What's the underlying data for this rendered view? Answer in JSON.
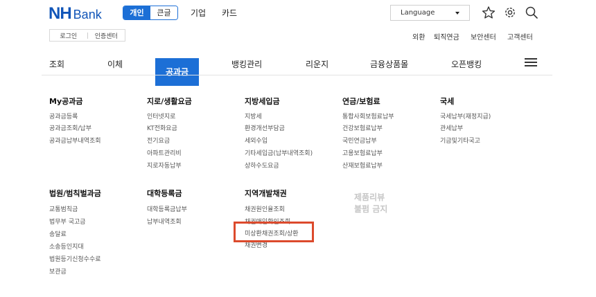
{
  "brand": {
    "nh": "NH",
    "bank": "Bank"
  },
  "segment": {
    "personal": "개인",
    "corporate": "큰글"
  },
  "top_menu": [
    "기업",
    "카드"
  ],
  "language": {
    "label": "Language"
  },
  "login_bar": {
    "login": "로그인",
    "cert": "인증센터"
  },
  "utility": [
    "외환",
    "퇴직연금",
    "보안센터",
    "고객센터"
  ],
  "gnb": {
    "items": [
      "조회",
      "이체",
      "공과금",
      "뱅킹관리",
      "리운지",
      "금융상품몰",
      "오픈뱅킹"
    ],
    "active": "공과금"
  },
  "columns": [
    {
      "title": "My공과금",
      "items": [
        "공과금등록",
        "공과금조회/납부",
        "공과금납부내역조회"
      ]
    },
    {
      "title": "지로/생활요금",
      "items": [
        "인터넷지로",
        "KT전화요금",
        "전기요금",
        "아파트관리비",
        "지로자동납부"
      ]
    },
    {
      "title": "지방세입금",
      "items": [
        "지방세",
        "환경개선부담금",
        "세외수입",
        "기타세입금(납부내역조회)",
        "상하수도요금"
      ]
    },
    {
      "title": "연금/보험료",
      "items": [
        "통합사회보험료납부",
        "건강보험료납부",
        "국민연금납부",
        "고용보험료납부",
        "산재보험료납부"
      ]
    },
    {
      "title": "국세",
      "items": [
        "국세납부(재정지급)",
        "관세납부",
        "기금및기타국고"
      ]
    },
    {
      "title": "법원/범칙벌과금",
      "items": [
        "교통범칙금",
        "법무부 국고금",
        "송달료",
        "소송등인지대",
        "법원등기신청수수료",
        "보관금"
      ]
    },
    {
      "title": "대학등록금",
      "items": [
        "대학등록금납부",
        "납부내역조회"
      ]
    },
    {
      "title": "지역개발채권",
      "items": [
        "채권원인율조회",
        "채권매입확인조회",
        "미상환채권조회/상환",
        "채권변경"
      ]
    }
  ],
  "watermark": {
    "line1": "제품리뷰",
    "line2": "불펌 금지"
  },
  "colors": {
    "brand_blue": "#1155b8",
    "accent_blue": "#1c6fd6",
    "highlight": "#dc4a2c"
  },
  "icons": [
    "star-icon",
    "gear-icon",
    "search-icon",
    "hamburger-menu-icon",
    "caret-down-icon"
  ]
}
